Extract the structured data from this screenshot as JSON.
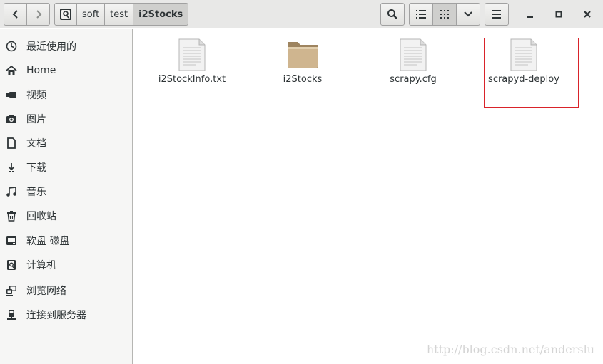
{
  "header": {
    "path": [
      "soft",
      "test",
      "i2Stocks"
    ],
    "active_path": "i2Stocks"
  },
  "sidebar": {
    "items": [
      {
        "label": "最近使用的",
        "icon": "clock-icon"
      },
      {
        "label": "Home",
        "icon": "home-icon"
      },
      {
        "label": "视频",
        "icon": "video-icon"
      },
      {
        "label": "图片",
        "icon": "camera-icon"
      },
      {
        "label": "文档",
        "icon": "document-icon"
      },
      {
        "label": "下载",
        "icon": "download-icon"
      },
      {
        "label": "音乐",
        "icon": "music-icon"
      },
      {
        "label": "回收站",
        "icon": "trash-icon"
      },
      {
        "label": "软盘 磁盘",
        "icon": "drive-icon"
      },
      {
        "label": "计算机",
        "icon": "computer-icon"
      },
      {
        "label": "浏览网络",
        "icon": "network-icon"
      },
      {
        "label": "连接到服务器",
        "icon": "server-icon"
      }
    ]
  },
  "files": [
    {
      "name": "i2StockInfo.txt",
      "type": "text-file-icon"
    },
    {
      "name": "i2Stocks",
      "type": "folder-icon"
    },
    {
      "name": "scrapy.cfg",
      "type": "text-file-icon"
    },
    {
      "name": "scrapyd-deploy",
      "type": "text-file-icon"
    }
  ],
  "watermark": "http://blog.csdn.net/anderslu",
  "colors": {
    "highlight_border": "#d9232a",
    "folder": "#cfb58f",
    "headerbar": "#e8e8e7"
  }
}
